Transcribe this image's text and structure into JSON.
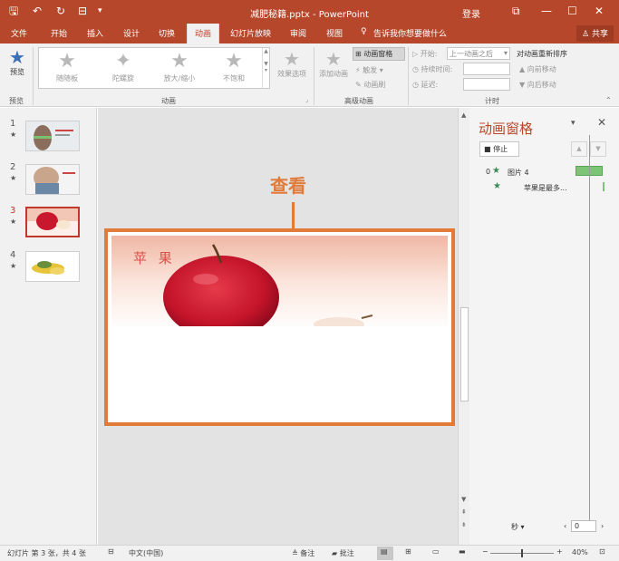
{
  "titlebar": {
    "title": "减肥秘籍.pptx - PowerPoint",
    "login": "登录",
    "qa_save": "🖫",
    "qa_undo": "↶",
    "qa_redo": "↻",
    "qa_present": "⊟",
    "qa_more": "▾",
    "restore": "⧉",
    "minimize": "—",
    "maximize": "☐",
    "close": "✕"
  },
  "tabs": [
    "文件",
    "开始",
    "插入",
    "设计",
    "切换",
    "动画",
    "幻灯片放映",
    "审阅",
    "视图"
  ],
  "active_tab": "动画",
  "tellme": "告诉我你想要做什么",
  "share": "共享",
  "ribbon": {
    "preview_label": "预览",
    "preview_group": "预览",
    "effects": [
      "随随板",
      "陀螺旋",
      "放大/缩小",
      "不饱和"
    ],
    "effect_options": "效果选项",
    "anim_group": "动画",
    "add_anim": "添加动画",
    "anim_pane_btn": "动画窗格",
    "trigger": "触发",
    "anim_painter": "动画刷",
    "adv_group": "高级动画",
    "start_label": "开始:",
    "start_value": "上一动画之后",
    "duration_label": "持续时间:",
    "delay_label": "延迟:",
    "reorder": "对动画重新排序",
    "move_earlier": "向前移动",
    "move_later": "向后移动",
    "timing_group": "计时"
  },
  "slides": [
    {
      "num": "1",
      "star": "★"
    },
    {
      "num": "2",
      "star": "★"
    },
    {
      "num": "3",
      "star": "★"
    },
    {
      "num": "4",
      "star": "★"
    }
  ],
  "canvas": {
    "callout": "查看",
    "slide_title": "苹 果"
  },
  "animpane": {
    "title": "动画窗格",
    "stop": "停止",
    "item0_num": "0",
    "item0_name": "图片 4",
    "item1_name": "苹果是最多...",
    "seconds": "秒",
    "timeline_value": "0"
  },
  "status": {
    "slide_info": "幻灯片 第 3 张，共 4 张",
    "lang": "中文(中国)",
    "notes": "备注",
    "comments": "批注",
    "zoom": "40%"
  },
  "colors": {
    "accent": "#b7472a",
    "callout": "#e07b39",
    "green": "#7cc576"
  }
}
